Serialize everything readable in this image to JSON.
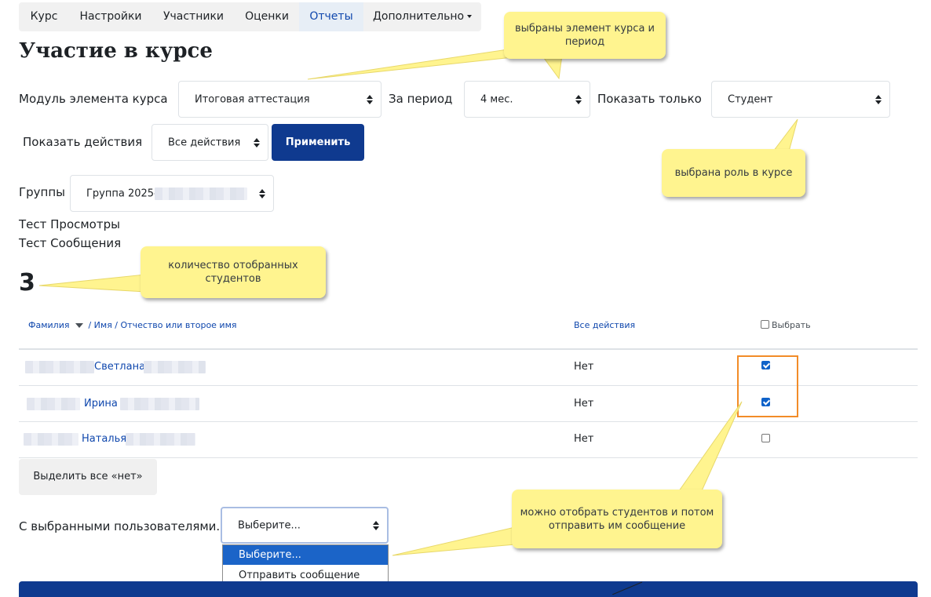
{
  "nav": {
    "tabs": [
      {
        "label": "Курс"
      },
      {
        "label": "Настройки"
      },
      {
        "label": "Участники"
      },
      {
        "label": "Оценки"
      },
      {
        "label": "Отчеты",
        "active": true
      },
      {
        "label": "Дополнительно"
      }
    ]
  },
  "page_title": "Участие в курсе",
  "filters": {
    "module_label": "Модуль элемента курса",
    "module_value": "Итоговая аттестация",
    "period_label": "За период",
    "period_value": "4 мес.",
    "show_only_label": "Показать только",
    "show_only_value": "Студент",
    "actions_label": "Показать действия",
    "actions_value": "Все действия",
    "apply_label": "Применить",
    "groups_label": "Группы",
    "groups_value": "Группа 2025-"
  },
  "info_lines": [
    "Тест Просмотры",
    "Тест Сообщения"
  ],
  "count": "3",
  "table": {
    "headers": {
      "surname": "Фамилия",
      "name_rest": "/ Имя / Отчество или второе имя",
      "all_actions": "Все действия",
      "select": "Выбрать"
    },
    "rows": [
      {
        "name": "Светлана",
        "value": "Нет",
        "checked": true
      },
      {
        "name": "Ирина",
        "value": "Нет",
        "checked": true
      },
      {
        "name": "Наталья",
        "value": "Нет",
        "checked": false
      }
    ]
  },
  "select_all_no_label": "Выделить все «нет»",
  "with_selected": {
    "label": "С выбранными пользователями...",
    "value": "Выберите...",
    "options": [
      "Выберите...",
      "Отправить сообщение"
    ]
  },
  "callouts": {
    "element_period": "выбраны элемент курса и период",
    "role": "выбрана роль в курсе",
    "count": "количество отобранных студентов",
    "message": "можно отобрать студентов и потом отправить им сообщение"
  },
  "colors": {
    "primary": "#0f3a8f",
    "link": "#0f47ad",
    "callout": "#fff48f",
    "highlight": "#f28c28",
    "checkbox": "#0f62c9"
  }
}
